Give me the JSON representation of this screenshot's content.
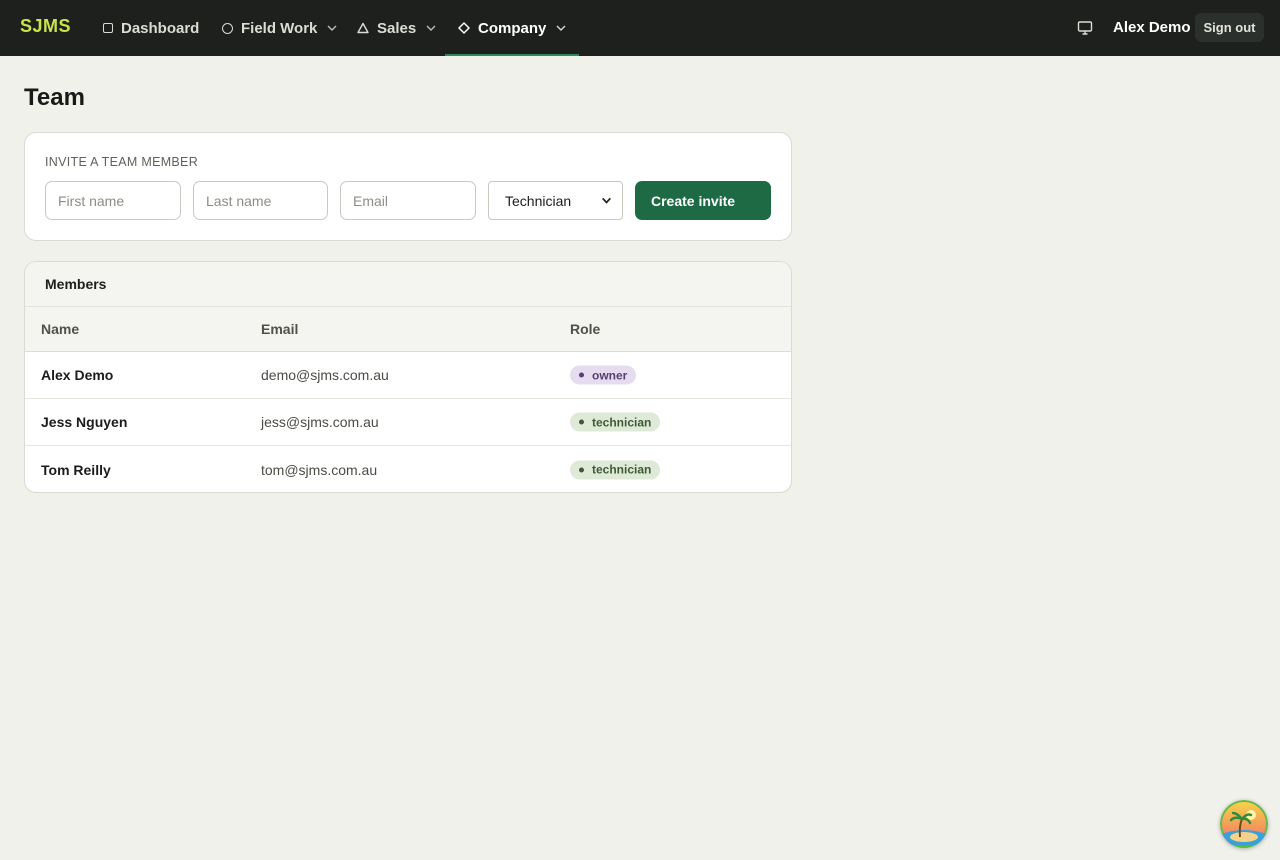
{
  "nav": {
    "brand": "SJMS",
    "items": [
      {
        "label": "Dashboard",
        "icon": "square-icon"
      },
      {
        "label": "Field Work",
        "icon": "circle-icon"
      },
      {
        "label": "Sales",
        "icon": "triangle-icon"
      },
      {
        "label": "Company",
        "icon": "diamond-icon",
        "active": true
      }
    ],
    "user": "Alex Demo",
    "sign_out": "Sign out"
  },
  "page": {
    "title": "Team"
  },
  "invite": {
    "heading": "INVITE A TEAM MEMBER",
    "first_name_placeholder": "First name",
    "last_name_placeholder": "Last name",
    "email_placeholder": "Email",
    "role_selected": "Technician",
    "create_label": "Create invite"
  },
  "members": {
    "title": "Members",
    "columns": [
      "Name",
      "Email",
      "Role"
    ],
    "rows": [
      {
        "name": "Alex Demo",
        "email": "demo@sjms.com.au",
        "role": "owner"
      },
      {
        "name": "Jess Nguyen",
        "email": "jess@sjms.com.au",
        "role": "technician"
      },
      {
        "name": "Tom Reilly",
        "email": "tom@sjms.com.au",
        "role": "technician"
      }
    ]
  },
  "colors": {
    "brand": "#c9e44a",
    "topbar": "#1d201d",
    "primary_button": "#1e6a44",
    "owner_badge": "#e6dcef",
    "technician_badge": "#dfe9d8"
  }
}
